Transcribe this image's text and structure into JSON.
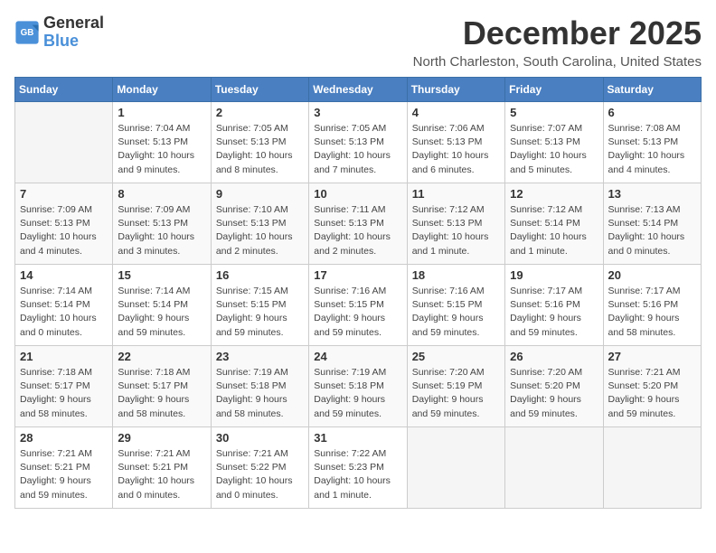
{
  "header": {
    "logo_line1": "General",
    "logo_line2": "Blue",
    "month": "December 2025",
    "location": "North Charleston, South Carolina, United States"
  },
  "weekdays": [
    "Sunday",
    "Monday",
    "Tuesday",
    "Wednesday",
    "Thursday",
    "Friday",
    "Saturday"
  ],
  "weeks": [
    [
      {
        "day": "",
        "info": ""
      },
      {
        "day": "1",
        "info": "Sunrise: 7:04 AM\nSunset: 5:13 PM\nDaylight: 10 hours\nand 9 minutes."
      },
      {
        "day": "2",
        "info": "Sunrise: 7:05 AM\nSunset: 5:13 PM\nDaylight: 10 hours\nand 8 minutes."
      },
      {
        "day": "3",
        "info": "Sunrise: 7:05 AM\nSunset: 5:13 PM\nDaylight: 10 hours\nand 7 minutes."
      },
      {
        "day": "4",
        "info": "Sunrise: 7:06 AM\nSunset: 5:13 PM\nDaylight: 10 hours\nand 6 minutes."
      },
      {
        "day": "5",
        "info": "Sunrise: 7:07 AM\nSunset: 5:13 PM\nDaylight: 10 hours\nand 5 minutes."
      },
      {
        "day": "6",
        "info": "Sunrise: 7:08 AM\nSunset: 5:13 PM\nDaylight: 10 hours\nand 4 minutes."
      }
    ],
    [
      {
        "day": "7",
        "info": "Sunrise: 7:09 AM\nSunset: 5:13 PM\nDaylight: 10 hours\nand 4 minutes."
      },
      {
        "day": "8",
        "info": "Sunrise: 7:09 AM\nSunset: 5:13 PM\nDaylight: 10 hours\nand 3 minutes."
      },
      {
        "day": "9",
        "info": "Sunrise: 7:10 AM\nSunset: 5:13 PM\nDaylight: 10 hours\nand 2 minutes."
      },
      {
        "day": "10",
        "info": "Sunrise: 7:11 AM\nSunset: 5:13 PM\nDaylight: 10 hours\nand 2 minutes."
      },
      {
        "day": "11",
        "info": "Sunrise: 7:12 AM\nSunset: 5:13 PM\nDaylight: 10 hours\nand 1 minute."
      },
      {
        "day": "12",
        "info": "Sunrise: 7:12 AM\nSunset: 5:14 PM\nDaylight: 10 hours\nand 1 minute."
      },
      {
        "day": "13",
        "info": "Sunrise: 7:13 AM\nSunset: 5:14 PM\nDaylight: 10 hours\nand 0 minutes."
      }
    ],
    [
      {
        "day": "14",
        "info": "Sunrise: 7:14 AM\nSunset: 5:14 PM\nDaylight: 10 hours\nand 0 minutes."
      },
      {
        "day": "15",
        "info": "Sunrise: 7:14 AM\nSunset: 5:14 PM\nDaylight: 9 hours\nand 59 minutes."
      },
      {
        "day": "16",
        "info": "Sunrise: 7:15 AM\nSunset: 5:15 PM\nDaylight: 9 hours\nand 59 minutes."
      },
      {
        "day": "17",
        "info": "Sunrise: 7:16 AM\nSunset: 5:15 PM\nDaylight: 9 hours\nand 59 minutes."
      },
      {
        "day": "18",
        "info": "Sunrise: 7:16 AM\nSunset: 5:15 PM\nDaylight: 9 hours\nand 59 minutes."
      },
      {
        "day": "19",
        "info": "Sunrise: 7:17 AM\nSunset: 5:16 PM\nDaylight: 9 hours\nand 59 minutes."
      },
      {
        "day": "20",
        "info": "Sunrise: 7:17 AM\nSunset: 5:16 PM\nDaylight: 9 hours\nand 58 minutes."
      }
    ],
    [
      {
        "day": "21",
        "info": "Sunrise: 7:18 AM\nSunset: 5:17 PM\nDaylight: 9 hours\nand 58 minutes."
      },
      {
        "day": "22",
        "info": "Sunrise: 7:18 AM\nSunset: 5:17 PM\nDaylight: 9 hours\nand 58 minutes."
      },
      {
        "day": "23",
        "info": "Sunrise: 7:19 AM\nSunset: 5:18 PM\nDaylight: 9 hours\nand 58 minutes."
      },
      {
        "day": "24",
        "info": "Sunrise: 7:19 AM\nSunset: 5:18 PM\nDaylight: 9 hours\nand 59 minutes."
      },
      {
        "day": "25",
        "info": "Sunrise: 7:20 AM\nSunset: 5:19 PM\nDaylight: 9 hours\nand 59 minutes."
      },
      {
        "day": "26",
        "info": "Sunrise: 7:20 AM\nSunset: 5:20 PM\nDaylight: 9 hours\nand 59 minutes."
      },
      {
        "day": "27",
        "info": "Sunrise: 7:21 AM\nSunset: 5:20 PM\nDaylight: 9 hours\nand 59 minutes."
      }
    ],
    [
      {
        "day": "28",
        "info": "Sunrise: 7:21 AM\nSunset: 5:21 PM\nDaylight: 9 hours\nand 59 minutes."
      },
      {
        "day": "29",
        "info": "Sunrise: 7:21 AM\nSunset: 5:21 PM\nDaylight: 10 hours\nand 0 minutes."
      },
      {
        "day": "30",
        "info": "Sunrise: 7:21 AM\nSunset: 5:22 PM\nDaylight: 10 hours\nand 0 minutes."
      },
      {
        "day": "31",
        "info": "Sunrise: 7:22 AM\nSunset: 5:23 PM\nDaylight: 10 hours\nand 1 minute."
      },
      {
        "day": "",
        "info": ""
      },
      {
        "day": "",
        "info": ""
      },
      {
        "day": "",
        "info": ""
      }
    ]
  ]
}
